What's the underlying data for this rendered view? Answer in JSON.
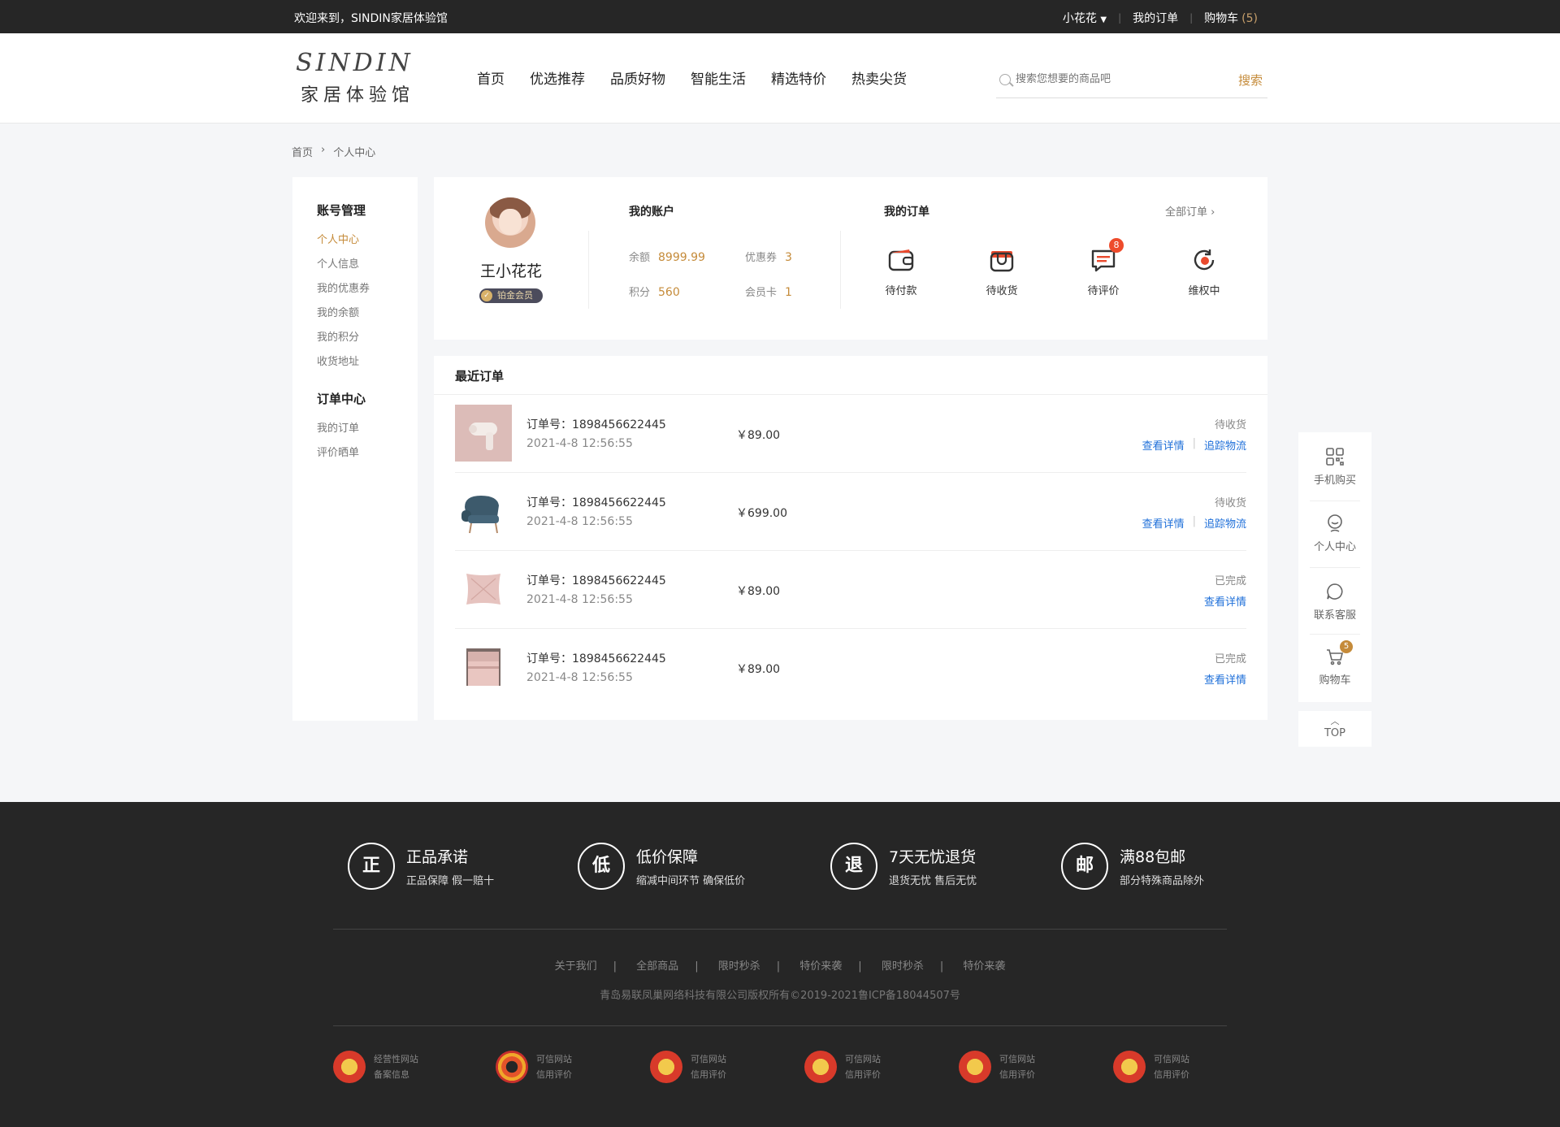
{
  "topbar": {
    "welcome": "欢迎来到，SINDIN家居体验馆",
    "user": "小花花",
    "my_orders": "我的订单",
    "cart": "购物车",
    "cart_count": "(5)"
  },
  "header": {
    "logo_top": "SINDIN",
    "logo_bottom": "家居体验馆",
    "nav": [
      "首页",
      "优选推荐",
      "品质好物",
      "智能生活",
      "精选特价",
      "热卖尖货"
    ],
    "search_placeholder": "搜索您想要的商品吧",
    "search_button": "搜索"
  },
  "breadcrumb": {
    "home": "首页",
    "sep": "›",
    "current": "个人中心"
  },
  "sidebar": {
    "groups": [
      {
        "title": "账号管理",
        "items": [
          "个人中心",
          "个人信息",
          "我的优惠券",
          "我的余额",
          "我的积分",
          "收货地址"
        ]
      },
      {
        "title": "订单中心",
        "items": [
          "我的订单",
          "评价晒单"
        ]
      }
    ]
  },
  "profile": {
    "name": "王小花花",
    "level": "铂金会员",
    "account_title": "我的账户",
    "balance_label": "余额",
    "balance": "8999.99",
    "coupon_label": "优惠券",
    "coupon": "3",
    "points_label": "积分",
    "points": "560",
    "card_label": "会员卡",
    "card": "1",
    "orders_title": "我的订单",
    "all_orders": "全部订单 ›",
    "order_states": [
      {
        "label": "待付款",
        "icon": "wallet-icon"
      },
      {
        "label": "待收货",
        "icon": "box-icon"
      },
      {
        "label": "待评价",
        "icon": "comment-icon",
        "badge": "8"
      },
      {
        "label": "维权中",
        "icon": "refresh-icon"
      }
    ]
  },
  "recent": {
    "title": "最近订单",
    "orders": [
      {
        "no": "订单号：1898456622445",
        "time": "2021-4-8 12:56:55",
        "price": "￥89.00",
        "status": "待收货",
        "link1": "查看详情",
        "link2": "追踪物流",
        "thumb": "hair-dryer"
      },
      {
        "no": "订单号：1898456622445",
        "time": "2021-4-8 12:56:55",
        "price": "￥699.00",
        "status": "待收货",
        "link1": "查看详情",
        "link2": "追踪物流",
        "thumb": "armchair"
      },
      {
        "no": "订单号：1898456622445",
        "time": "2021-4-8 12:56:55",
        "price": "￥89.00",
        "status": "已完成",
        "link1": "查看详情",
        "thumb": "pillow"
      },
      {
        "no": "订单号：1898456622445",
        "time": "2021-4-8 12:56:55",
        "price": "￥89.00",
        "status": "已完成",
        "link1": "查看详情",
        "thumb": "bedding"
      }
    ]
  },
  "float": {
    "items": [
      "手机购买",
      "个人中心",
      "联系客服",
      "购物车"
    ],
    "cart_badge": "5",
    "top": "TOP"
  },
  "footer": {
    "guarantees": [
      {
        "char": "正",
        "title": "正品承诺",
        "sub": "正品保障 假一赔十"
      },
      {
        "char": "低",
        "title": "低价保障",
        "sub": "缩减中间环节 确保低价"
      },
      {
        "char": "退",
        "title": "7天无忧退货",
        "sub": "退货无忧 售后无忧"
      },
      {
        "char": "邮",
        "title": "满88包邮",
        "sub": "部分特殊商品除外"
      }
    ],
    "links": [
      "关于我们",
      "全部商品",
      "限时秒杀",
      "特价来袭",
      "限时秒杀",
      "特价来袭"
    ],
    "link_sep": "|",
    "copyright": "青岛易联凤巢网络科技有限公司版权所有©2019-2021鲁ICP备18044507号",
    "certs": [
      {
        "l1": "经营性网站",
        "l2": "备案信息"
      },
      {
        "l1": "可信网站",
        "l2": "信用评价"
      },
      {
        "l1": "可信网站",
        "l2": "信用评价"
      },
      {
        "l1": "可信网站",
        "l2": "信用评价"
      },
      {
        "l1": "可信网站",
        "l2": "信用评价"
      },
      {
        "l1": "可信网站",
        "l2": "信用评价"
      }
    ]
  },
  "colors": {
    "accent": "#c58b3a",
    "link": "#1e6fd9",
    "dark": "#262626",
    "badge_red": "#ee4b2b"
  }
}
